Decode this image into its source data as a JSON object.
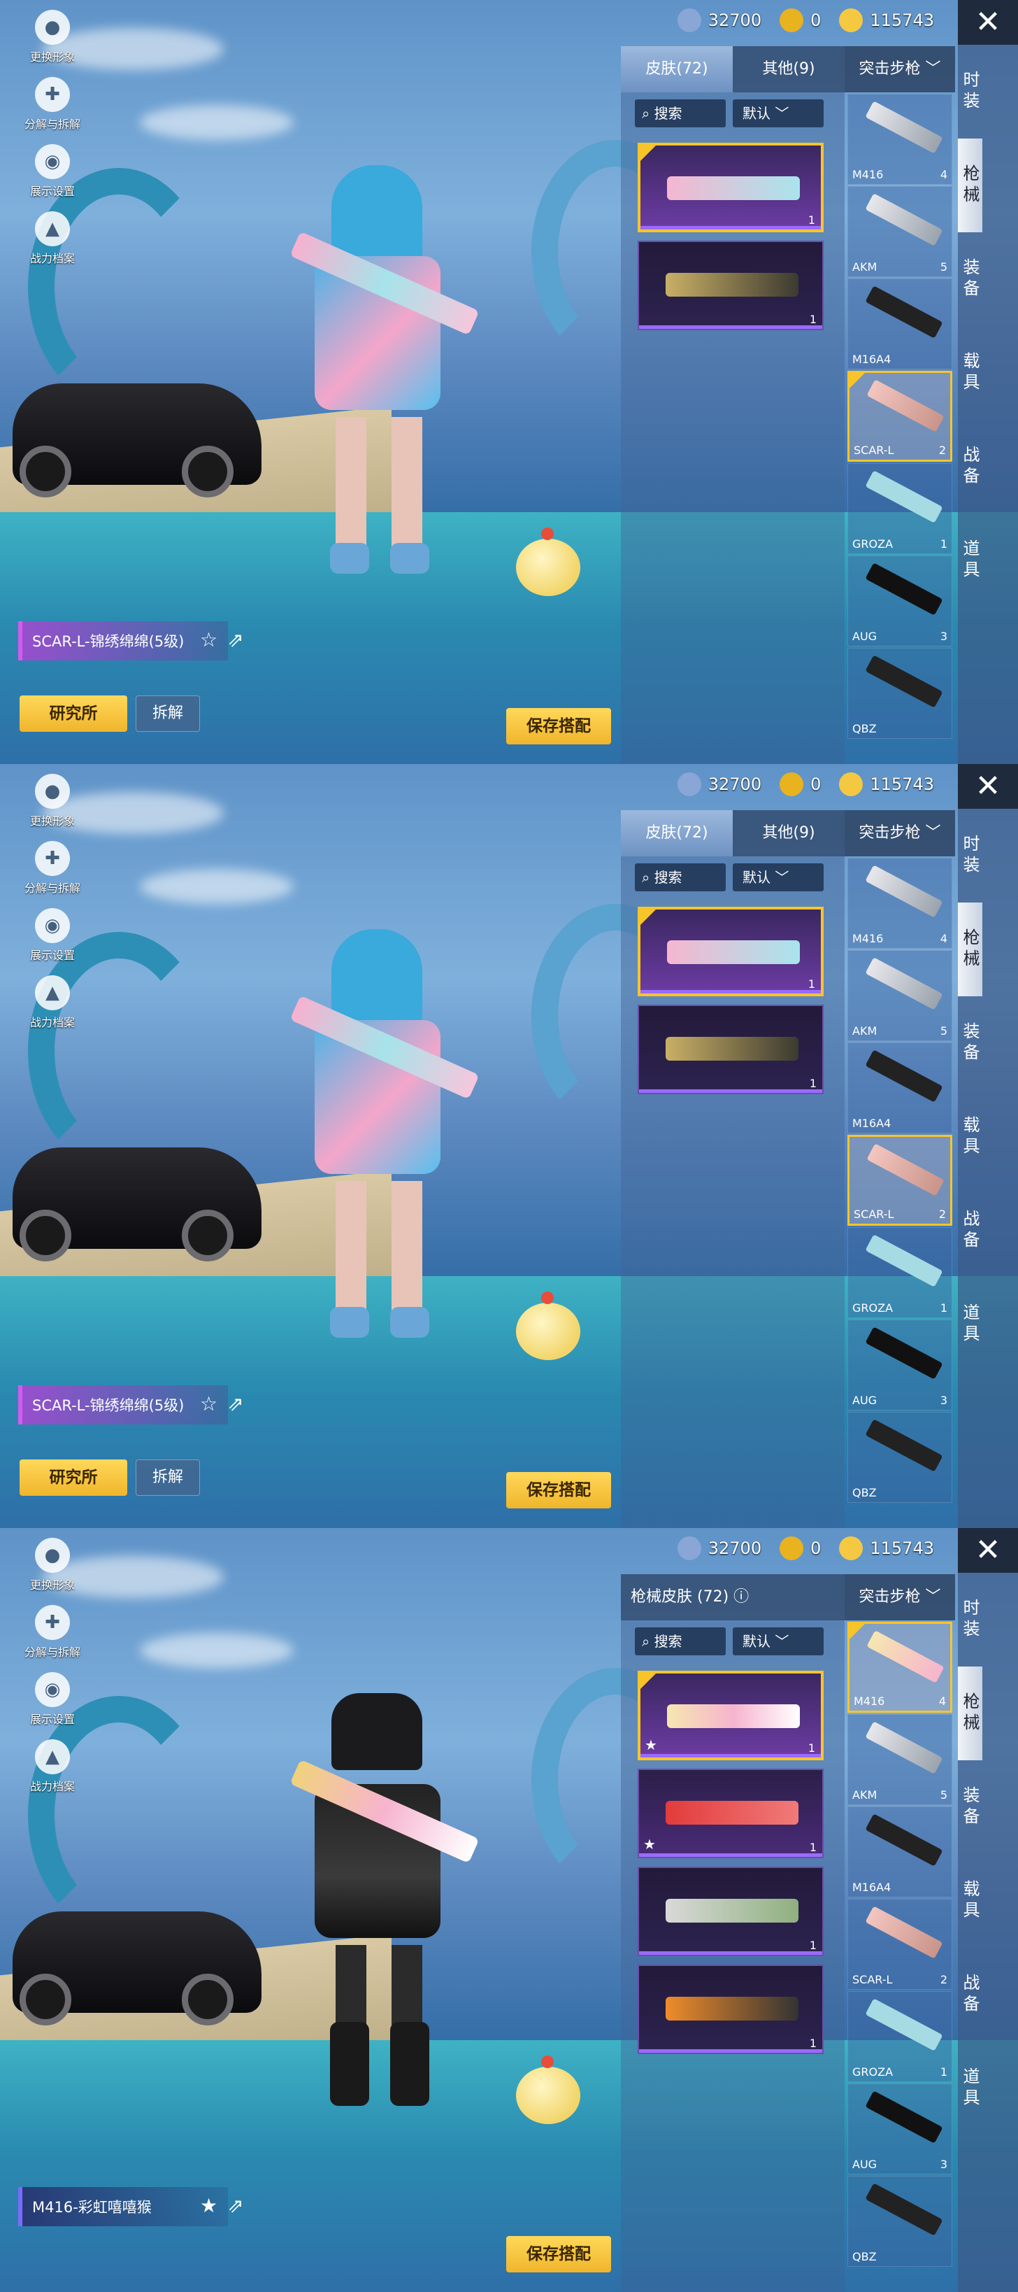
{
  "currency": {
    "silver": "32700",
    "ag": "0",
    "uc": "115743"
  },
  "left_menu": [
    "更换形象",
    "分解与拆解",
    "展示设置",
    "战力档案"
  ],
  "categories": [
    "时装",
    "枪械",
    "装备",
    "载具",
    "战备",
    "道具"
  ],
  "filter": {
    "label": "突击步枪",
    "search": "搜索",
    "sort": "默认"
  },
  "screens": [
    {
      "tabs": [
        "皮肤(72)",
        "其他(9)"
      ],
      "skin_name": "SCAR-L-锦绣绵绵(5级)",
      "lab_btn": "研究所",
      "dismantle_btn": "拆解",
      "save_btn": "保存搭配",
      "skins": [
        {
          "count": "1"
        },
        {
          "count": "1"
        }
      ],
      "weapons": [
        {
          "name": "M416",
          "count": "4"
        },
        {
          "name": "AKM",
          "count": "5"
        },
        {
          "name": "M16A4",
          "count": ""
        },
        {
          "name": "SCAR-L",
          "count": "2"
        },
        {
          "name": "GROZA",
          "count": "1"
        },
        {
          "name": "AUG",
          "count": "3"
        },
        {
          "name": "QBZ",
          "count": ""
        }
      ]
    },
    {
      "tabs": [
        "皮肤(72)",
        "其他(9)"
      ],
      "skin_name": "SCAR-L-锦绣绵绵(5级)",
      "lab_btn": "研究所",
      "dismantle_btn": "拆解",
      "save_btn": "保存搭配",
      "skins": [
        {
          "count": "1"
        },
        {
          "count": "1"
        }
      ],
      "weapons": [
        {
          "name": "M416",
          "count": "4"
        },
        {
          "name": "AKM",
          "count": "5"
        },
        {
          "name": "M16A4",
          "count": ""
        },
        {
          "name": "SCAR-L",
          "count": "2"
        },
        {
          "name": "GROZA",
          "count": "1"
        },
        {
          "name": "AUG",
          "count": "3"
        },
        {
          "name": "QBZ",
          "count": ""
        }
      ]
    },
    {
      "panel_title": "枪械皮肤 (72)",
      "skin_name": "M416-彩虹嘻嘻猴",
      "save_btn": "保存搭配",
      "skins": [
        {
          "count": "1"
        },
        {
          "count": "1"
        },
        {
          "count": "1"
        },
        {
          "count": "1"
        }
      ],
      "weapons": [
        {
          "name": "M416",
          "count": "4"
        },
        {
          "name": "AKM",
          "count": "5"
        },
        {
          "name": "M16A4",
          "count": ""
        },
        {
          "name": "SCAR-L",
          "count": "2"
        },
        {
          "name": "GROZA",
          "count": "1"
        },
        {
          "name": "AUG",
          "count": "3"
        },
        {
          "name": "QBZ",
          "count": ""
        }
      ]
    }
  ],
  "colors": {
    "gold": "#f7c52a",
    "purple": "#9a6bff"
  }
}
